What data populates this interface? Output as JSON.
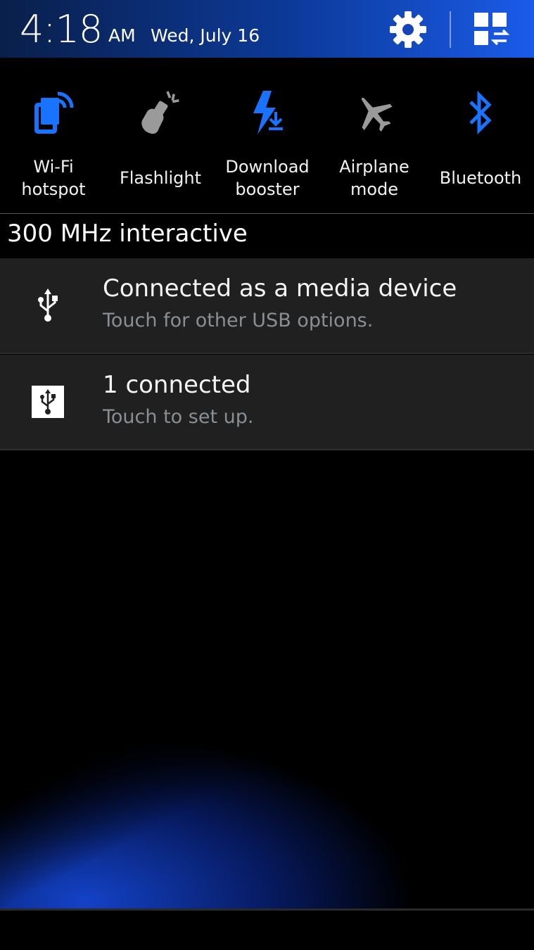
{
  "header": {
    "time": "4:18",
    "ampm": "AM",
    "date": "Wed, July 16",
    "settings_icon": "gear-icon",
    "edit_icon": "grid-toggle-icon"
  },
  "toggles": [
    {
      "label": "Wi-Fi\nhotspot",
      "icon": "wifi-hotspot-icon",
      "active": true
    },
    {
      "label": "Flashlight",
      "icon": "flashlight-icon",
      "active": false
    },
    {
      "label": "Download\nbooster",
      "icon": "download-booster-icon",
      "active": true
    },
    {
      "label": "Airplane\nmode",
      "icon": "airplane-icon",
      "active": false
    },
    {
      "label": "Bluetooth",
      "icon": "bluetooth-icon",
      "active": true
    }
  ],
  "cpu_status": "300 MHz interactive",
  "notifications": [
    {
      "title": "Connected as a media device",
      "subtitle": "Touch for other USB options.",
      "icon": "usb-icon"
    },
    {
      "title": "1 connected",
      "subtitle": "Touch to set up.",
      "icon": "usb-tethering-icon"
    }
  ],
  "colors": {
    "accent": "#1a73ff",
    "inactive_icon": "#9a9a9a",
    "notif_bg": "#202020",
    "subtitle": "#8a8f93"
  }
}
